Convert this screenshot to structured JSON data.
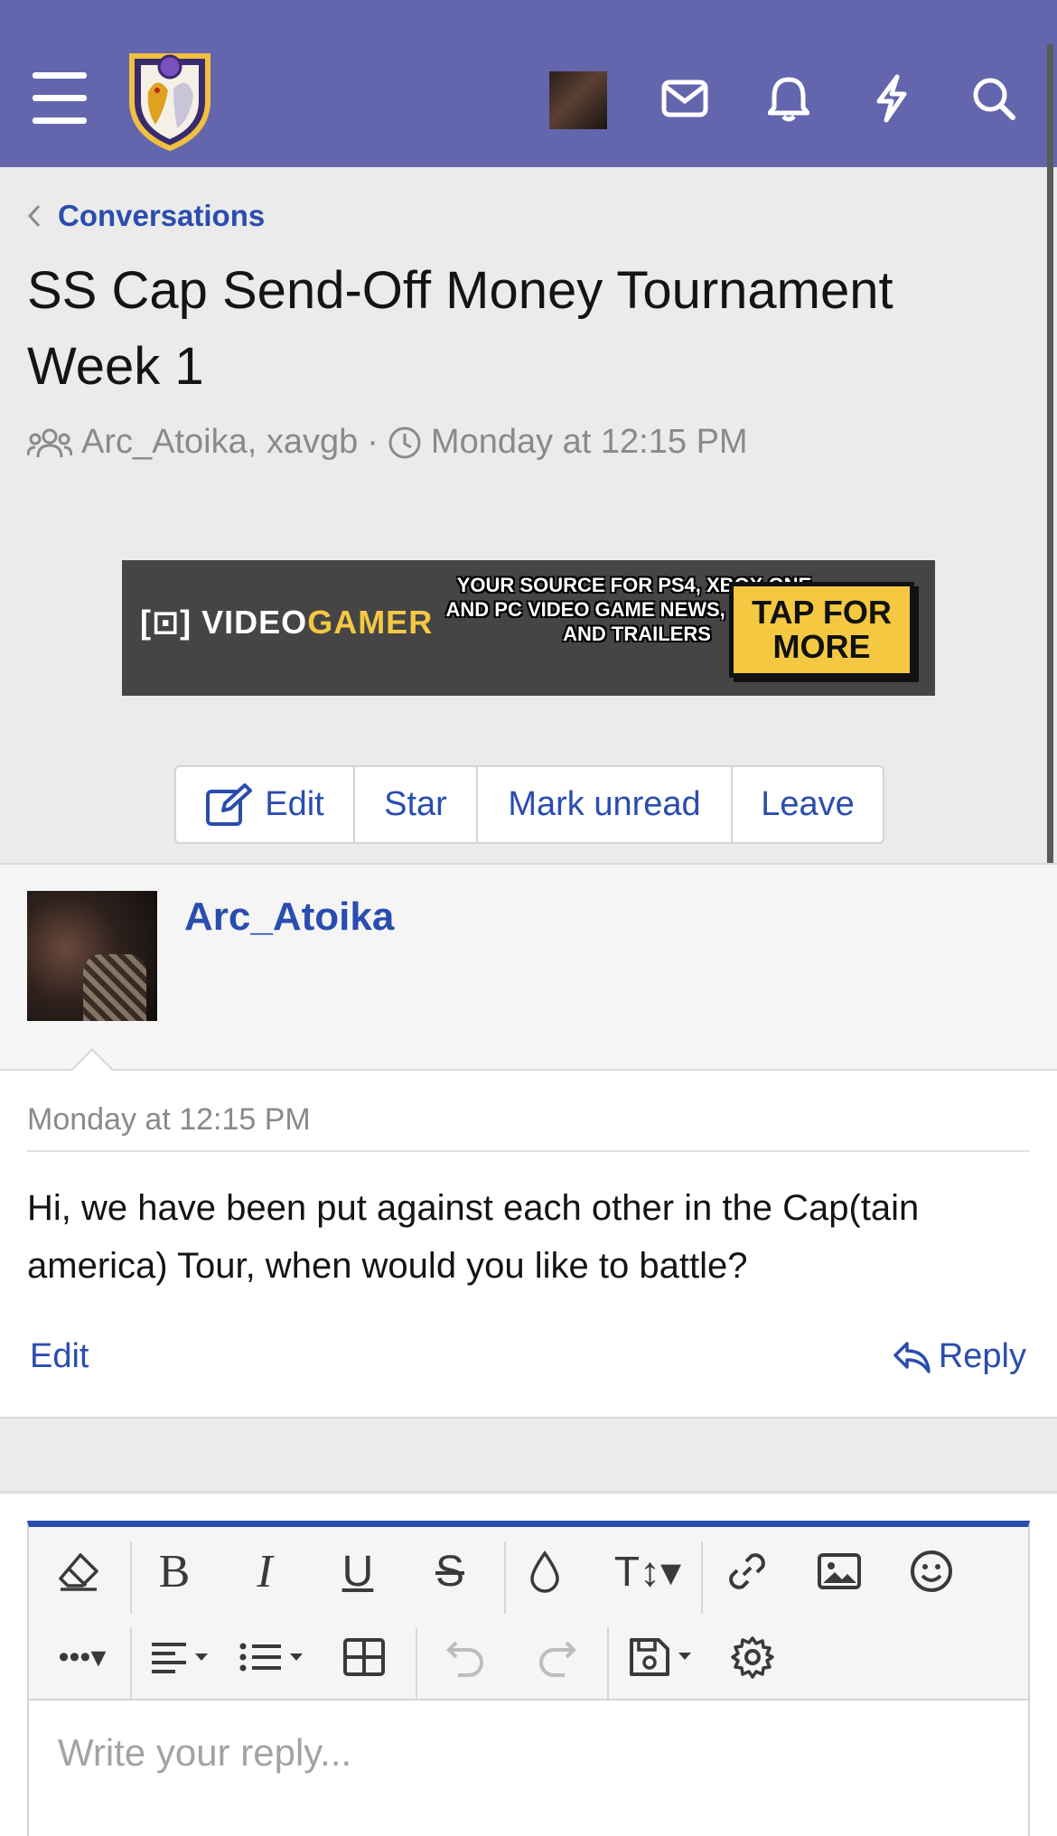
{
  "header": {
    "icons": [
      "menu-icon",
      "site-logo",
      "user-avatar",
      "inbox-icon",
      "bell-icon",
      "bolt-icon",
      "search-icon"
    ]
  },
  "breadcrumb": {
    "label": "Conversations"
  },
  "conversation": {
    "title": "SS Cap Send-Off Money Tournament Week 1",
    "participants": "Arc_Atoika, xavgb",
    "separator": "·",
    "started": "Monday at 12:15 PM"
  },
  "ad": {
    "brand_a": "VIDEO",
    "brand_b": "GAMER",
    "tagline": "YOUR SOURCE FOR PS4, XBOX ONE, AND PC VIDEO GAME NEWS, REVIEWS, AND TRAILERS",
    "cta": "TAP FOR MORE"
  },
  "actions": {
    "edit": "Edit",
    "star": "Star",
    "mark_unread": "Mark unread",
    "leave": "Leave"
  },
  "message": {
    "author": "Arc_Atoika",
    "date": "Monday at 12:15 PM",
    "text": "Hi, we have been put against each other in the Cap(tain america) Tour, when would you like to battle?",
    "edit": "Edit",
    "reply": "Reply"
  },
  "editor": {
    "placeholder": "Write your reply...",
    "accent": "#2a4dae"
  },
  "colors": {
    "header_bg": "#6366ad",
    "link": "#2a4dae",
    "page_bg": "#ebebeb"
  }
}
